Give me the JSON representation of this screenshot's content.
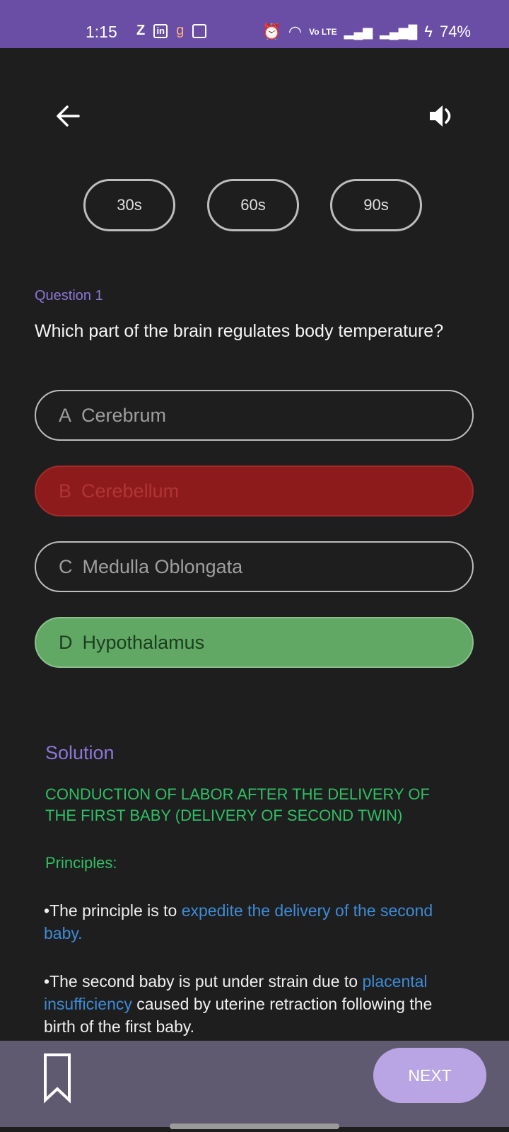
{
  "status_bar": {
    "time": "1:15",
    "left_icons": [
      "z-icon",
      "linkedin-icon",
      "g-icon",
      "calendar-icon"
    ],
    "battery": "74%",
    "network": "Vo LTE",
    "color": "#6a4ea6"
  },
  "header": {
    "back_icon": "arrow-left-icon",
    "sound_icon": "speaker-icon"
  },
  "timers": [
    "30s",
    "60s",
    "90s"
  ],
  "question": {
    "label": "Question 1",
    "text": "Which part of the brain regulates body temperature?"
  },
  "options": [
    {
      "letter": "A",
      "text": "Cerebrum",
      "state": "neutral"
    },
    {
      "letter": "B",
      "text": "Cerebellum",
      "state": "wrong",
      "color": "#8e1b1b"
    },
    {
      "letter": "C",
      "text": "Medulla Oblongata",
      "state": "neutral"
    },
    {
      "letter": "D",
      "text": "Hypothalamus",
      "state": "correct",
      "color": "#61a865"
    }
  ],
  "solution": {
    "title": "Solution",
    "heading": "CONDUCTION OF LABOR AFTER THE DELIVERY OF THE FIRST BABY (DELIVERY OF SECOND TWIN)",
    "principles_label": "Principles:",
    "bullet1": {
      "prefix": "•The principle is to ",
      "highlight": "expedite the delivery of the second baby."
    },
    "bullet2": {
      "prefix": "•The second baby is put under strain due to ",
      "highlight": "placental insufficiency",
      "suffix": " caused by uterine retraction following the birth of the first baby."
    }
  },
  "footer": {
    "bookmark_icon": "bookmark-icon",
    "next_label": "NEXT"
  }
}
